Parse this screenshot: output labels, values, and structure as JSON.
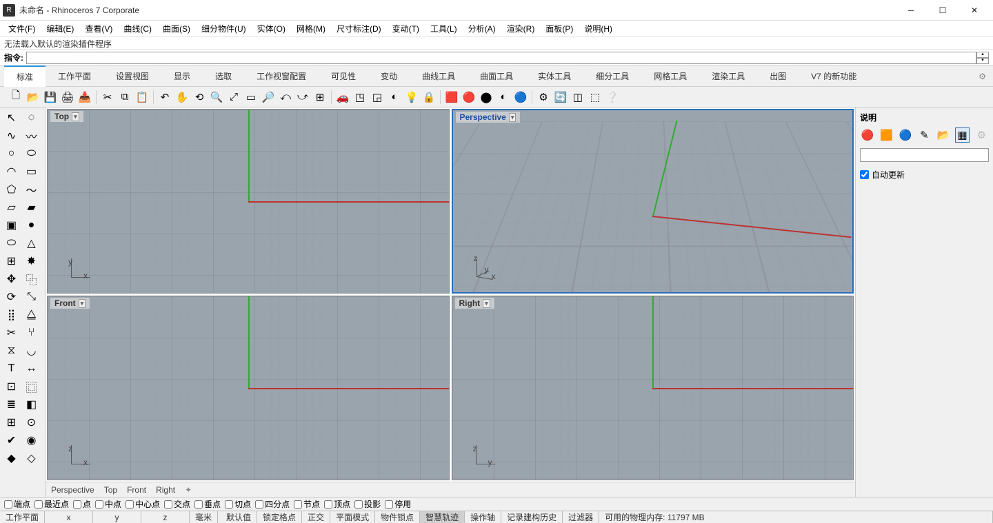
{
  "window": {
    "title": "未命名 - Rhinoceros 7 Corporate"
  },
  "menu": {
    "items": [
      "文件(F)",
      "编辑(E)",
      "查看(V)",
      "曲线(C)",
      "曲面(S)",
      "细分物件(U)",
      "实体(O)",
      "网格(M)",
      "尺寸标注(D)",
      "变动(T)",
      "工具(L)",
      "分析(A)",
      "渲染(R)",
      "面板(P)",
      "说明(H)"
    ]
  },
  "command": {
    "history": "无法载入默认的渲染插件程序",
    "prompt": "指令:",
    "value": ""
  },
  "tabs": {
    "items": [
      "标准",
      "工作平面",
      "设置视图",
      "显示",
      "选取",
      "工作视窗配置",
      "可见性",
      "变动",
      "曲线工具",
      "曲面工具",
      "实体工具",
      "细分工具",
      "网格工具",
      "渲染工具",
      "出图",
      "V7 的新功能"
    ],
    "active": 0
  },
  "toolbar_standard": [
    {
      "n": "new-icon",
      "g": "🗋"
    },
    {
      "n": "open-icon",
      "g": "📂"
    },
    {
      "n": "save-icon",
      "g": "💾"
    },
    {
      "n": "print-icon",
      "g": "🖨"
    },
    {
      "n": "import-icon",
      "g": "📥"
    },
    {
      "n": "sep"
    },
    {
      "n": "cut-icon",
      "g": "✂"
    },
    {
      "n": "copy-icon",
      "g": "⧉"
    },
    {
      "n": "paste-icon",
      "g": "📋"
    },
    {
      "n": "sep"
    },
    {
      "n": "undo-icon",
      "g": "↶"
    },
    {
      "n": "pan-icon",
      "g": "✋"
    },
    {
      "n": "rotate-icon",
      "g": "⟲"
    },
    {
      "n": "zoom-sel-icon",
      "g": "🔍"
    },
    {
      "n": "zoom-ext-icon",
      "g": "⤢"
    },
    {
      "n": "zoom-window-icon",
      "g": "▭"
    },
    {
      "n": "zoom-dyn-icon",
      "g": "🔎"
    },
    {
      "n": "undo-view-icon",
      "g": "⤺"
    },
    {
      "n": "redo-view-icon",
      "g": "⤻"
    },
    {
      "n": "four-view-icon",
      "g": "⊞"
    },
    {
      "n": "sep"
    },
    {
      "n": "truck-icon",
      "g": "🚗"
    },
    {
      "n": "cplane-world-icon",
      "g": "◳"
    },
    {
      "n": "cplane-obj-icon",
      "g": "◲"
    },
    {
      "n": "shade-icon",
      "g": "◐"
    },
    {
      "n": "light-icon",
      "g": "💡"
    },
    {
      "n": "lock-icon",
      "g": "🔒"
    },
    {
      "n": "sep"
    },
    {
      "n": "render-icon",
      "g": "🟥"
    },
    {
      "n": "materials-icon",
      "g": "🔴"
    },
    {
      "n": "env-icon",
      "g": "⬤"
    },
    {
      "n": "texture-icon",
      "g": "◐"
    },
    {
      "n": "sphere-blue-icon",
      "g": "🔵"
    },
    {
      "n": "sep"
    },
    {
      "n": "options-icon",
      "g": "⚙"
    },
    {
      "n": "refresh-icon",
      "g": "🔄"
    },
    {
      "n": "cplane2-icon",
      "g": "◫"
    },
    {
      "n": "cplane3-icon",
      "g": "⬚"
    },
    {
      "n": "help-icon",
      "g": "❔"
    }
  ],
  "sidetoolbar": [
    {
      "n": "pointer-icon",
      "g": "↖"
    },
    {
      "n": "lasso-icon",
      "g": "◌"
    },
    {
      "n": "polyline-icon",
      "g": "∿"
    },
    {
      "n": "curve-icon",
      "g": "〰"
    },
    {
      "n": "circle-icon",
      "g": "○"
    },
    {
      "n": "ellipse-icon",
      "g": "⬭"
    },
    {
      "n": "arc-icon",
      "g": "◠"
    },
    {
      "n": "rect-icon",
      "g": "▭"
    },
    {
      "n": "polygon-icon",
      "g": "⬠"
    },
    {
      "n": "freeform-icon",
      "g": "～"
    },
    {
      "n": "surface-icon",
      "g": "▱"
    },
    {
      "n": "loft-icon",
      "g": "▰"
    },
    {
      "n": "box-icon",
      "g": "▣"
    },
    {
      "n": "sphere-icon",
      "g": "●"
    },
    {
      "n": "cylinder-icon",
      "g": "⬭"
    },
    {
      "n": "cone-icon",
      "g": "△"
    },
    {
      "n": "mesh-icon",
      "g": "⊞"
    },
    {
      "n": "explode-icon",
      "g": "✸"
    },
    {
      "n": "move-icon",
      "g": "✥"
    },
    {
      "n": "copy2-icon",
      "g": "⿻"
    },
    {
      "n": "rotate2-icon",
      "g": "⟳"
    },
    {
      "n": "scale-icon",
      "g": "⤡"
    },
    {
      "n": "array-icon",
      "g": "⣿"
    },
    {
      "n": "mirror-icon",
      "g": "⧋"
    },
    {
      "n": "trim-icon",
      "g": "✂"
    },
    {
      "n": "split-icon",
      "g": "⑂"
    },
    {
      "n": "join-icon",
      "g": "⧖"
    },
    {
      "n": "fillet-icon",
      "g": "◡"
    },
    {
      "n": "text-icon",
      "g": "T"
    },
    {
      "n": "dim-icon",
      "g": "↔"
    },
    {
      "n": "blocks-icon",
      "g": "⊡"
    },
    {
      "n": "group-icon",
      "g": "⿴"
    },
    {
      "n": "layers-icon",
      "g": "≣"
    },
    {
      "n": "properties-icon",
      "g": "◧"
    },
    {
      "n": "grid-icon",
      "g": "⊞"
    },
    {
      "n": "snap-icon",
      "g": "⊙"
    },
    {
      "n": "check-icon",
      "g": "✔"
    },
    {
      "n": "analyze-icon",
      "g": "◉"
    },
    {
      "n": "render2-icon",
      "g": "◆"
    },
    {
      "n": "render3-icon",
      "g": "◇"
    }
  ],
  "viewports": {
    "top": {
      "label": "Top",
      "ax1": "y",
      "ax2": "x"
    },
    "perspective": {
      "label": "Perspective",
      "ax1": "z",
      "ax2": "y",
      "ax3": "x",
      "active": true
    },
    "front": {
      "label": "Front",
      "ax1": "z",
      "ax2": "x"
    },
    "right": {
      "label": "Right",
      "ax1": "z",
      "ax2": "y"
    }
  },
  "viewtabs": [
    "Perspective",
    "Top",
    "Front",
    "Right"
  ],
  "rightpanel": {
    "title": "说明",
    "input": "",
    "autoupdate": "自动更新"
  },
  "osnap": {
    "items": [
      "端点",
      "最近点",
      "点",
      "中点",
      "中心点",
      "交点",
      "垂点",
      "切点",
      "四分点",
      "节点",
      "顶点",
      "投影",
      "停用"
    ]
  },
  "status": {
    "cplane": "工作平面",
    "x": "x",
    "y": "y",
    "z": "z",
    "unit": "毫米",
    "layer": "默认值",
    "items": [
      "锁定格点",
      "正交",
      "平面模式",
      "物件锁点",
      "智慧轨迹",
      "操作轴",
      "记录建构历史",
      "过滤器"
    ],
    "active_item": "智慧轨迹",
    "memory": "可用的物理内存: 11797 MB"
  }
}
